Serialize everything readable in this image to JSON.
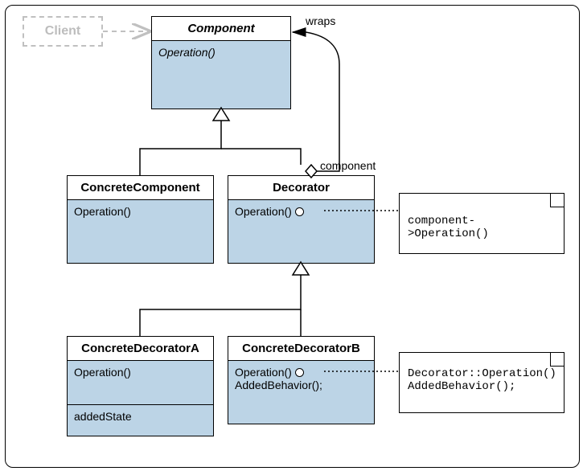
{
  "diagram": {
    "client": "Client",
    "component": {
      "name": "Component",
      "op": "Operation()"
    },
    "concreteComponent": {
      "name": "ConcreteComponent",
      "op": "Operation()"
    },
    "decorator": {
      "name": "Decorator",
      "op": "Operation()"
    },
    "concreteDecoratorA": {
      "name": "ConcreteDecoratorA",
      "op": "Operation()",
      "state": "addedState"
    },
    "concreteDecoratorB": {
      "name": "ConcreteDecoratorB",
      "op": "Operation()",
      "behavior": "AddedBehavior();"
    },
    "note1": "component->Operation()",
    "note2a": "Decorator::Operation()",
    "note2b": "AddedBehavior();",
    "labels": {
      "wraps": "wraps",
      "component": "component"
    }
  }
}
